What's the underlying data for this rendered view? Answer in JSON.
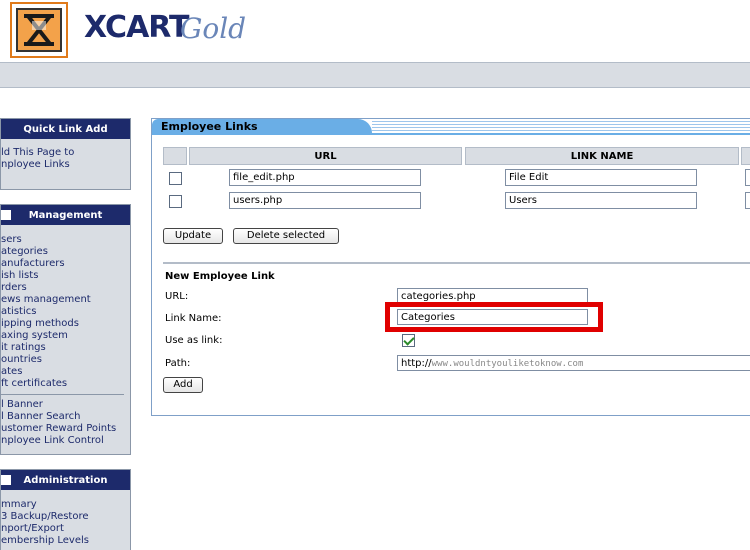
{
  "brand": {
    "name": "XCART",
    "edition": "Gold"
  },
  "menus": {
    "quick_link": {
      "title": "Quick Link Add",
      "items": [
        "ld This Page to",
        "nployee Links"
      ]
    },
    "management": {
      "title": "Management",
      "items": [
        "sers",
        "ategories",
        "anufacturers",
        "ish lists",
        "rders",
        "ews management",
        "atistics",
        "ipping methods",
        "axing system",
        "it ratings",
        "ountries",
        "ates",
        "ft certificates"
      ],
      "items2": [
        "l Banner",
        "l Banner Search",
        "ustomer Reward Points",
        "nployee Link Control"
      ]
    },
    "administration": {
      "title": "Administration",
      "items": [
        "mmary",
        "3 Backup/Restore",
        "nport/Export",
        "embership Levels"
      ]
    }
  },
  "panel": {
    "title": "Employee Links",
    "columns": {
      "url": "URL",
      "link_name": "LINK NAME"
    },
    "rows": [
      {
        "url": "file_edit.php",
        "link_name": "File Edit"
      },
      {
        "url": "users.php",
        "link_name": "Users"
      }
    ],
    "update_label": "Update",
    "delete_label": "Delete selected",
    "new_section_title": "New Employee Link",
    "url_label": "URL:",
    "url_value": "categories.php",
    "link_name_label": "Link Name:",
    "link_name_value": "Categories",
    "use_as_link_label": "Use as link:",
    "path_label": "Path:",
    "path_prefix": "http://",
    "path_value": "www.wouldntyouliketoknow.com",
    "add_label": "Add"
  },
  "colors": {
    "accent": "#1d2a6b",
    "tab": "#6aaee6",
    "highlight": "#e00000"
  }
}
